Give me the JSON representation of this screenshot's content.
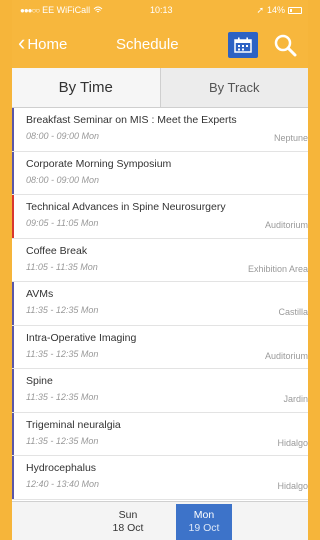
{
  "status_bar": {
    "carrier": "EE WiFiCall",
    "time": "10:13",
    "battery": "14%"
  },
  "navbar": {
    "back_label": "Home",
    "title": "Schedule",
    "calendar_icon": "calendar-icon",
    "search_icon": "search-icon"
  },
  "tabs": [
    {
      "label": "By Time",
      "active": true
    },
    {
      "label": "By Track",
      "active": false
    }
  ],
  "sessions": [
    {
      "title": "Breakfast Seminar on MIS :  Meet the Experts",
      "time": "08:00 - 09:00 Mon",
      "location": "Neptune",
      "color": "#5b57a8"
    },
    {
      "title": "Corporate Morning Symposium",
      "time": "08:00 - 09:00 Mon",
      "location": "",
      "color": "#5b57a8"
    },
    {
      "title": "Technical Advances in Spine Neurosurgery",
      "time": "09:05 - 11:05 Mon",
      "location": "Auditorium",
      "color": "#d9382f"
    },
    {
      "title": "Coffee Break",
      "time": "11:05 - 11:35 Mon",
      "location": "Exhibition Area",
      "color": "#ffffff"
    },
    {
      "title": "AVMs",
      "time": "11:35 - 12:35 Mon",
      "location": "Castilla",
      "color": "#5b57a8"
    },
    {
      "title": "Intra-Operative Imaging",
      "time": "11:35 - 12:35 Mon",
      "location": "Auditorium",
      "color": "#5b57a8"
    },
    {
      "title": "Spine",
      "time": "11:35 - 12:35 Mon",
      "location": "Jardin",
      "color": "#5b57a8"
    },
    {
      "title": "Trigeminal neuralgia",
      "time": "11:35 - 12:35 Mon",
      "location": "Hidalgo",
      "color": "#5b57a8"
    },
    {
      "title": "Hydrocephalus",
      "time": "12:40 - 13:40 Mon",
      "location": "Hidalgo",
      "color": "#5b57a8"
    }
  ],
  "days": [
    {
      "day": "Sun",
      "date": "18 Oct",
      "selected": false
    },
    {
      "day": "Mon",
      "date": "19 Oct",
      "selected": true
    }
  ],
  "colors": {
    "accent": "#f7b73d",
    "selected_day": "#3d73c9",
    "calendar_button": "#2d62c4"
  }
}
